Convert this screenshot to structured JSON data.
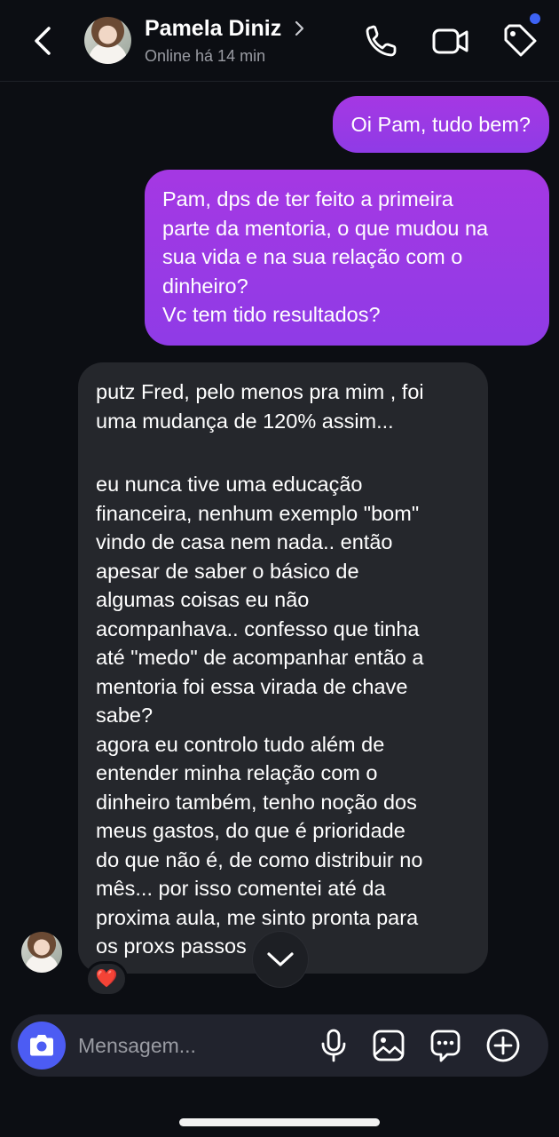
{
  "header": {
    "contact_name": "Pamela Diniz",
    "status": "Online há 14 min",
    "icons": [
      "back-icon",
      "chevron-right-icon",
      "phone-icon",
      "video-icon",
      "tag-icon"
    ],
    "notification_dot_color": "#3d63f5"
  },
  "messages": [
    {
      "direction": "sent",
      "lines": [
        "Oi Pam, tudo bem?"
      ]
    },
    {
      "direction": "sent",
      "lines": [
        "Pam, dps de ter feito a primeira",
        "parte da mentoria, o que mudou na",
        "sua vida e na sua relação com o",
        "dinheiro?",
        "Vc tem tido resultados?"
      ]
    },
    {
      "direction": "received",
      "lines": [
        "putz Fred, pelo menos pra mim , foi",
        "uma mudança de 120% assim...",
        "",
        "eu nunca tive uma educação",
        "financeira, nenhum exemplo \"bom\"",
        "vindo de casa nem nada.. então",
        "apesar de saber o básico de",
        "algumas coisas eu não",
        "acompanhava.. confesso que tinha",
        "até \"medo\" de acompanhar então a",
        "mentoria foi essa virada de chave",
        "sabe?",
        "agora eu controlo tudo além de",
        "entender minha relação com o",
        "dinheiro também, tenho noção dos",
        "meus gastos, do que é prioridade",
        "do que não é, de como distribuir no",
        "mês... por isso comentei até da",
        "proxima aula, me sinto pronta para",
        "os proxs passos"
      ],
      "reaction": "❤️"
    }
  ],
  "composer": {
    "placeholder": "Mensagem...",
    "icons": [
      "camera-icon",
      "microphone-icon",
      "image-icon",
      "sticker-icon",
      "plus-icon"
    ]
  },
  "colors": {
    "background": "#0c0e13",
    "sent_bubble_top": "#a538e3",
    "sent_bubble_bottom": "#8f3be6",
    "received_bubble": "#25272c",
    "camera_button": "#4c5cf3"
  }
}
